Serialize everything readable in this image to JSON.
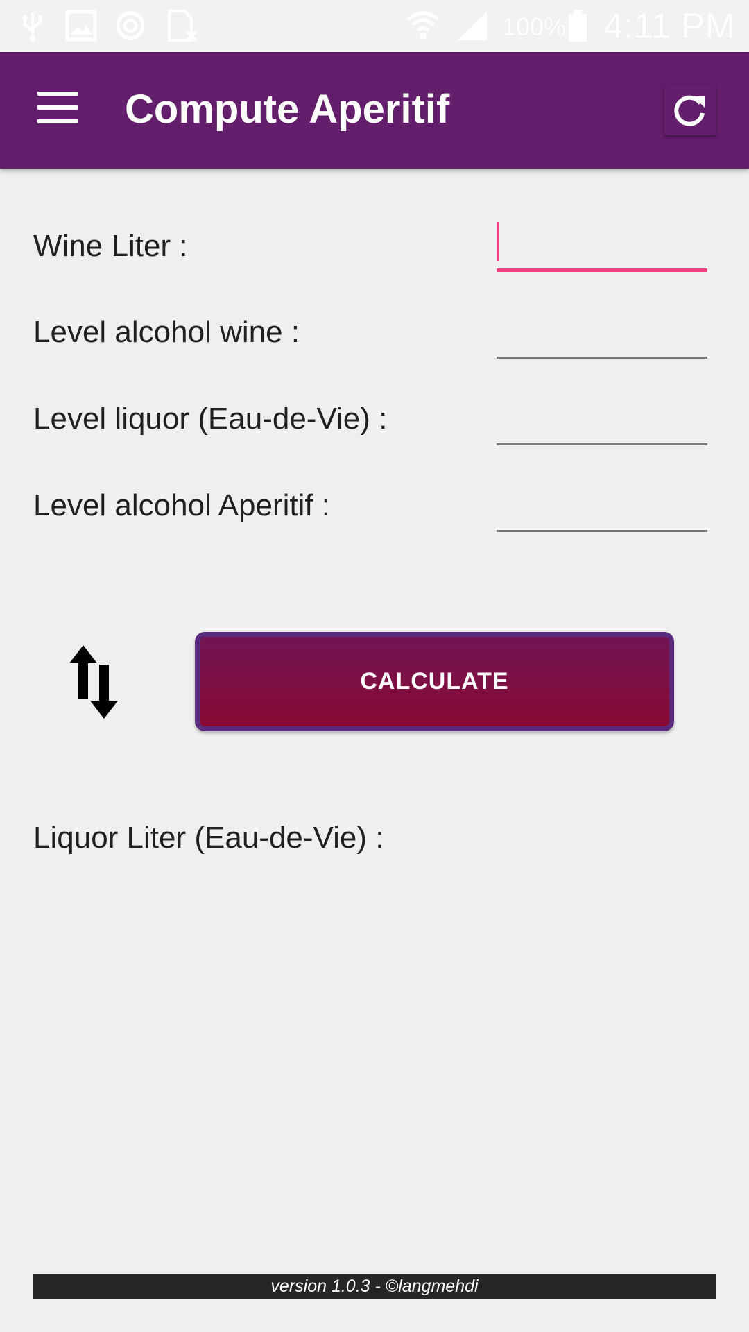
{
  "status_bar": {
    "icons": [
      "usb-icon",
      "image-icon",
      "sync-icon",
      "no-sim-icon",
      "wifi-icon",
      "signal-icon",
      "battery-icon"
    ],
    "battery": "100%",
    "time": "4:11 PM"
  },
  "app_bar": {
    "title": "Compute Aperitif",
    "color": "#631e6c",
    "menu_icon": "hamburger-menu-icon",
    "refresh_icon": "refresh-icon"
  },
  "form": {
    "wine_liter": {
      "label": "Wine Liter :",
      "value": ""
    },
    "level_alcohol_wine": {
      "label": "Level alcohol wine :",
      "value": ""
    },
    "level_liquor": {
      "label": "Level liquor (Eau-de-Vie) :",
      "value": ""
    },
    "level_alcohol_aperitif": {
      "label": "Level alcohol Aperitif :",
      "value": ""
    }
  },
  "actions": {
    "swap_icon": "swap-vertical-icon",
    "calculate_label": "CALCULATE"
  },
  "result": {
    "label": "Liquor Liter (Eau-de-Vie) :",
    "value": ""
  },
  "footer": {
    "version": "version 1.0.3 - ©langmehdi"
  },
  "colors": {
    "accent": "#e94481",
    "button_start": "#721553",
    "button_end": "#880a34",
    "button_border": "#5a2a7e",
    "background": "#efefef"
  }
}
